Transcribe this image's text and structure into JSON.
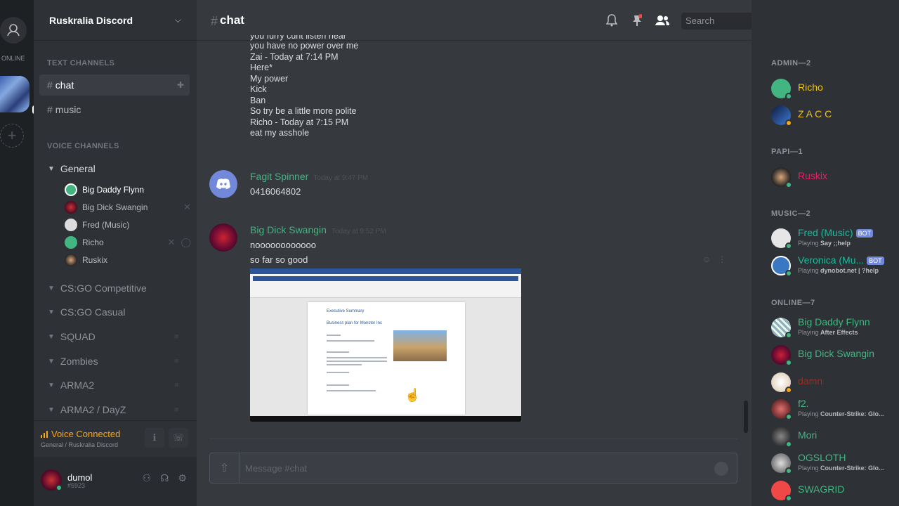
{
  "guilds": {
    "online_label": "ONLINE"
  },
  "server": {
    "name": "Ruskralia Discord"
  },
  "sidebar": {
    "text_category": "TEXT CHANNELS",
    "text_channels": [
      {
        "label": "chat"
      },
      {
        "label": "music"
      }
    ],
    "voice_category": "VOICE CHANNELS",
    "voice_groups": [
      {
        "label": "General"
      },
      {
        "label": "CS:GO Competitive"
      },
      {
        "label": "CS:GO Casual"
      },
      {
        "label": "SQUAD"
      },
      {
        "label": "Zombies"
      },
      {
        "label": "ARMA2"
      },
      {
        "label": "ARMA2 / DayZ"
      }
    ],
    "voice_users": [
      {
        "name": "Big Daddy Flynn"
      },
      {
        "name": "Big Dick Swangin"
      },
      {
        "name": "Fred (Music)"
      },
      {
        "name": "Richo"
      },
      {
        "name": "Ruskix"
      }
    ]
  },
  "voice_panel": {
    "title": "Voice Connected",
    "subtitle": "General / Ruskralia Discord"
  },
  "user_panel": {
    "username": "dumol",
    "tag": "#5923"
  },
  "chat": {
    "channel_name": "chat",
    "search_placeholder": "Search",
    "old_lines": [
      "you furry cunt listen hear",
      "you have no power over me",
      "Zai - Today at 7:14 PM",
      "Here*",
      "My power",
      "Kick",
      "Ban",
      "So try be a little more polite",
      "Richo - Today at 7:15 PM",
      "eat my asshole"
    ],
    "messages": [
      {
        "author": "Fagit Spinner",
        "timestamp": "Today at 9:47 PM",
        "lines": [
          "0416064802"
        ]
      },
      {
        "author": "Big Dick Swangin",
        "timestamp": "Today at 9:52 PM",
        "lines": [
          "noooooooooooo",
          "so far so good"
        ]
      }
    ],
    "embed": {
      "heading": "Executive Summary",
      "subheading": "Business plan for Monster Inc"
    },
    "composer_placeholder": "Message #chat"
  },
  "members": {
    "groups": [
      {
        "label": "ADMIN—2",
        "items": [
          {
            "name": "Richo",
            "color": "#f1c40f",
            "status": "#43b581"
          },
          {
            "name": "Z A C C",
            "color": "#f1c40f",
            "status": "#faa61a"
          }
        ]
      },
      {
        "label": "PAPI—1",
        "items": [
          {
            "name": "Ruskix",
            "color": "#e91e63",
            "status": "#43b581"
          }
        ]
      },
      {
        "label": "MUSIC—2",
        "items": [
          {
            "name": "Fred (Music)",
            "color": "#1abc9c",
            "bot": "BOT",
            "playing": "Playing",
            "game": "Say ;;help"
          },
          {
            "name": "Veronica (Mu...",
            "color": "#1abc9c",
            "bot": "BOT",
            "playing": "Playing",
            "game": "dynobot.net | ?help"
          }
        ]
      },
      {
        "label": "ONLINE—7",
        "items": [
          {
            "name": "Big Daddy Flynn",
            "color": "#43b581",
            "playing": "Playing",
            "game": "After Effects"
          },
          {
            "name": "Big Dick Swangin",
            "color": "#43b581"
          },
          {
            "name": "damn",
            "color": "#992d22"
          },
          {
            "name": "f2.",
            "color": "#43b581",
            "playing": "Playing",
            "game": "Counter-Strike: Glo..."
          },
          {
            "name": "Mori",
            "color": "#43b581"
          },
          {
            "name": "OGSLOTH",
            "color": "#43b581",
            "playing": "Playing",
            "game": "Counter-Strike: Glo..."
          },
          {
            "name": "SWAGRID",
            "color": "#43b581"
          }
        ]
      }
    ]
  }
}
